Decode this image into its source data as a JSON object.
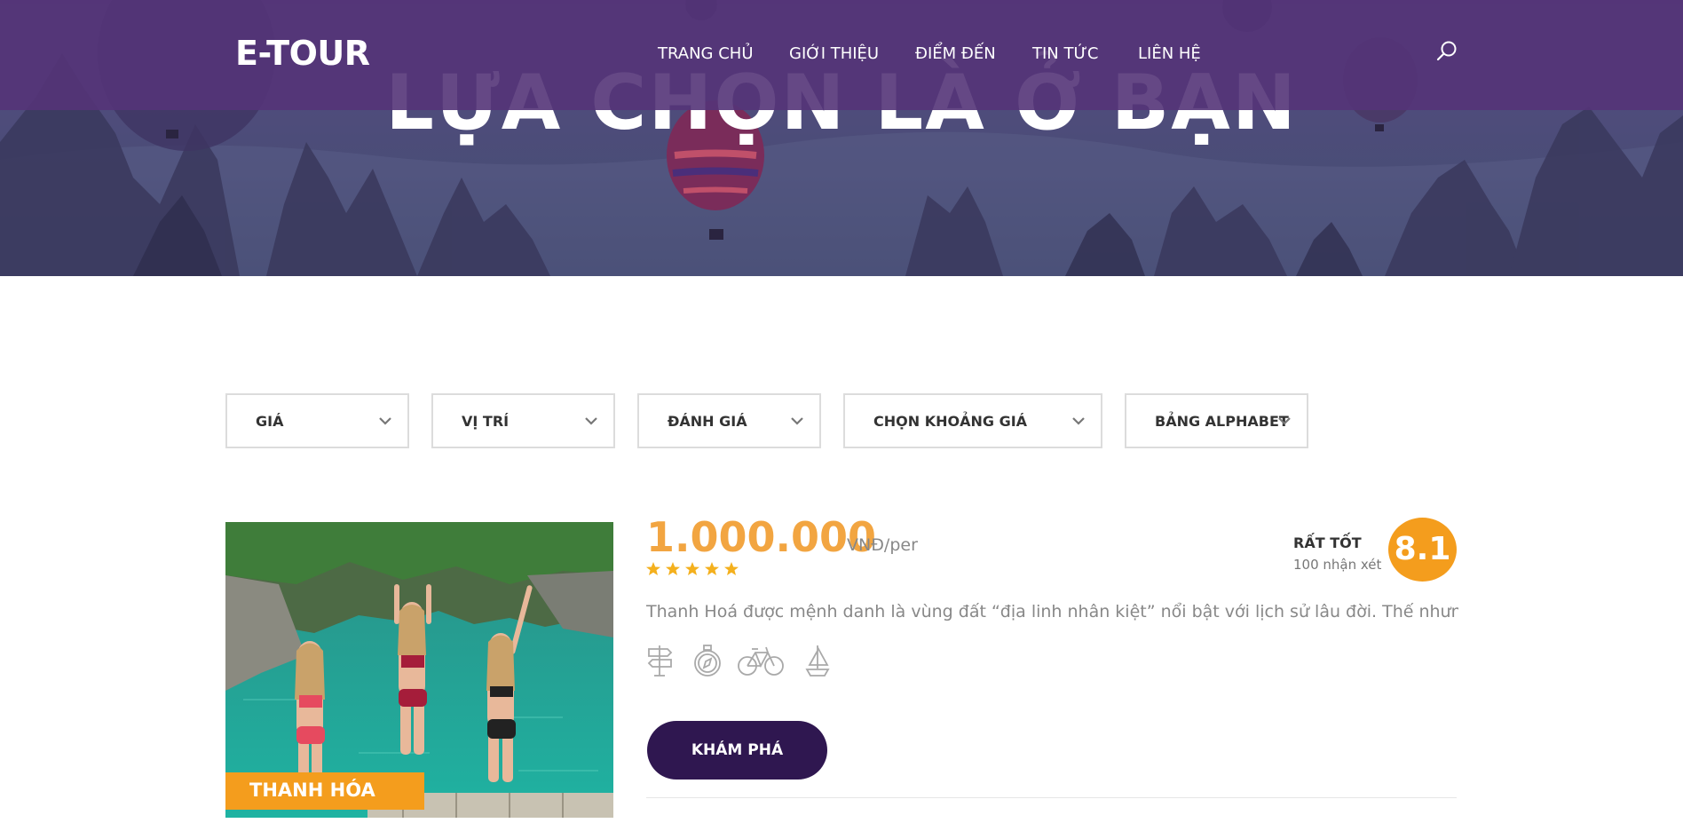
{
  "header": {
    "logo": "E-TOUR",
    "nav": [
      "TRANG CHỦ",
      "GIỚI THIỆU",
      "ĐIỂM ĐẾN",
      "TIN TỨC",
      "LIÊN HỆ"
    ],
    "search_icon": "search-icon"
  },
  "hero": {
    "title": "LỰA CHỌN LÀ Ở BẠN"
  },
  "filters": [
    "GIÁ",
    "VỊ TRÍ",
    "ĐÁNH GIÁ",
    "CHỌN KHOẢNG GIÁ",
    "BẢNG ALPHABET"
  ],
  "tour": {
    "location": "THANH HÓA",
    "price": "1.000.000",
    "unit": "VNĐ/per",
    "stars": 5,
    "rating_label": "RẤT TỐT",
    "review_count": "100 nhận xét",
    "score": "8.1",
    "description": "Thanh Hoá được mệnh danh là vùng đất “địa linh nhân kiệt” nổi bật với lịch sử lâu đời. Thế nhưng có thể với ...",
    "amenities": [
      "signpost-icon",
      "compass-icon",
      "bicycle-icon",
      "sailboat-icon"
    ],
    "button": "KHÁM PHÁ"
  },
  "colors": {
    "header_bg": "#543478",
    "accent_orange": "#f49d1d",
    "price_color": "#f2a541",
    "button_bg": "#2f1750"
  }
}
